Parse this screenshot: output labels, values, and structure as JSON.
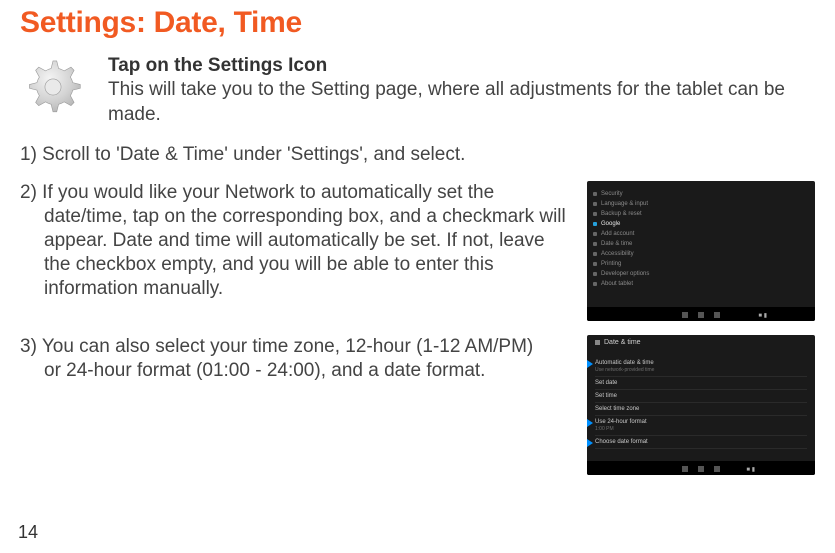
{
  "title": "Settings: Date, Time",
  "intro": {
    "heading": "Tap on the Settings Icon",
    "body": "This will take you to the Setting page, where all adjustments for the tablet can be made."
  },
  "step1": "1) Scroll to 'Date & Time' under 'Settings', and select.",
  "step2_line1": "2) If you would like your Network to automatically set the",
  "step2_rest": "date/time, tap on the corresponding box, and a checkmark will appear.  Date and time will automatically be set.  If not, leave the checkbox empty, and you will be able to enter this information manually.",
  "step3_line1": "3) You can also select your time zone, 12-hour (1-12 AM/PM)",
  "step3_rest": "or 24-hour format (01:00 - 24:00), and a date format.",
  "page_number": "14",
  "screenshot1": {
    "sidebar_items": [
      {
        "label": "Security",
        "active": false
      },
      {
        "label": "Language & input",
        "active": false
      },
      {
        "label": "Backup & reset",
        "active": false
      },
      {
        "label": "Google",
        "active": true
      },
      {
        "label": "Add account",
        "active": false
      },
      {
        "label": "Date & time",
        "active": false
      },
      {
        "label": "Accessibility",
        "active": false
      },
      {
        "label": "Printing",
        "active": false
      },
      {
        "label": "Developer options",
        "active": false
      },
      {
        "label": "About tablet",
        "active": false
      }
    ]
  },
  "screenshot2": {
    "header": "Date & time",
    "rows": [
      {
        "main": "Automatic date & time",
        "sub": "Use network-provided time",
        "marker": true
      },
      {
        "main": "Set date",
        "sub": "",
        "marker": false
      },
      {
        "main": "Set time",
        "sub": "",
        "marker": false
      },
      {
        "main": "Select time zone",
        "sub": "",
        "marker": false
      },
      {
        "main": "Use 24-hour format",
        "sub": "1:00 PM",
        "marker": true
      },
      {
        "main": "Choose date format",
        "sub": "",
        "marker": true
      }
    ]
  }
}
